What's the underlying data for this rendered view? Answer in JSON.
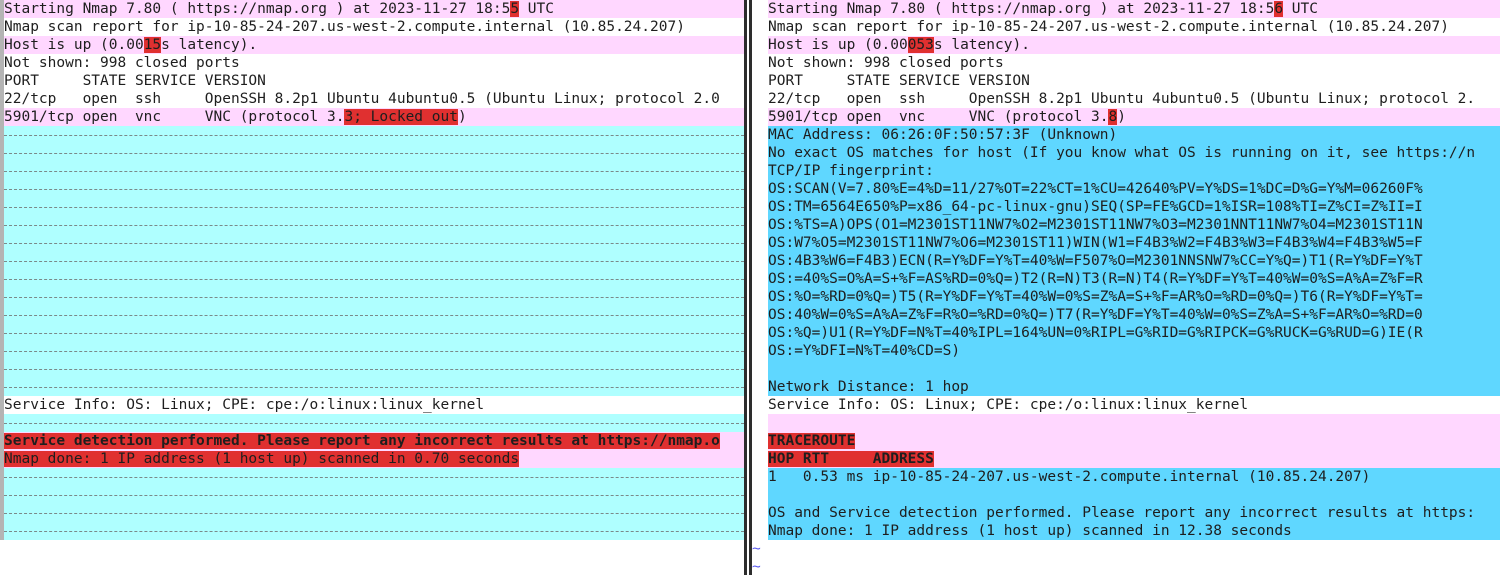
{
  "left": {
    "header1": {
      "pre": "Starting Nmap 7.80 ( https://nmap.org ) at 2023-11-27 18:5",
      "hl": "5",
      "post": " UTC"
    },
    "header2": "Nmap scan report for ip-10-85-24-207.us-west-2.compute.internal (10.85.24.207)",
    "latency": {
      "pre": "Host is up (0.00",
      "hl": "15",
      "post": "s latency)."
    },
    "closed": "Not shown: 998 closed ports",
    "columns": "PORT     STATE SERVICE VERSION",
    "ssh_row": "22/tcp   open  ssh     OpenSSH 8.2p1 Ubuntu 4ubuntu0.5 (Ubuntu Linux; protocol 2.0",
    "vnc_row": {
      "pre": "5901/tcp open  vnc     VNC (protocol 3.",
      "hl": "3; Locked out",
      "post": ")"
    },
    "service_info": "Service Info: OS: Linux; CPE: cpe:/o:linux:linux_kernel",
    "detection": "Service detection performed. Please report any incorrect results at https://nmap.o",
    "done": "Nmap done: 1 IP address (1 host up) scanned in 0.70 seconds"
  },
  "right": {
    "header1": {
      "pre": "Starting Nmap 7.80 ( https://nmap.org ) at 2023-11-27 18:5",
      "hl": "6",
      "post": " UTC"
    },
    "header2": "Nmap scan report for ip-10-85-24-207.us-west-2.compute.internal (10.85.24.207)",
    "latency": {
      "pre": "Host is up (0.00",
      "hl": "053",
      "post": "s latency)."
    },
    "closed": "Not shown: 998 closed ports",
    "columns": "PORT     STATE SERVICE VERSION",
    "ssh_row": "22/tcp   open  ssh     OpenSSH 8.2p1 Ubuntu 4ubuntu0.5 (Ubuntu Linux; protocol 2.",
    "vnc_row": {
      "pre": "5901/tcp open  vnc     VNC (protocol 3.",
      "hl": "8",
      "post": ")"
    },
    "os_block": [
      "MAC Address: 06:26:0F:50:57:3F (Unknown)",
      "No exact OS matches for host (If you know what OS is running on it, see https://n",
      "TCP/IP fingerprint:",
      "OS:SCAN(V=7.80%E=4%D=11/27%OT=22%CT=1%CU=42640%PV=Y%DS=1%DC=D%G=Y%M=06260F%",
      "OS:TM=6564E650%P=x86_64-pc-linux-gnu)SEQ(SP=FE%GCD=1%ISR=108%TI=Z%CI=Z%II=I",
      "OS:%TS=A)OPS(O1=M2301ST11NW7%O2=M2301ST11NW7%O3=M2301NNT11NW7%O4=M2301ST11N",
      "OS:W7%O5=M2301ST11NW7%O6=M2301ST11)WIN(W1=F4B3%W2=F4B3%W3=F4B3%W4=F4B3%W5=F",
      "OS:4B3%W6=F4B3)ECN(R=Y%DF=Y%T=40%W=F507%O=M2301NNSNW7%CC=Y%Q=)T1(R=Y%DF=Y%T",
      "OS:=40%S=O%A=S+%F=AS%RD=0%Q=)T2(R=N)T3(R=N)T4(R=Y%DF=Y%T=40%W=0%S=A%A=Z%F=R",
      "OS:%O=%RD=0%Q=)T5(R=Y%DF=Y%T=40%W=0%S=Z%A=S+%F=AR%O=%RD=0%Q=)T6(R=Y%DF=Y%T=",
      "OS:40%W=0%S=A%A=Z%F=R%O=%RD=0%Q=)T7(R=Y%DF=Y%T=40%W=0%S=Z%A=S+%F=AR%O=%RD=0",
      "OS:%Q=)U1(R=Y%DF=N%T=40%IPL=164%UN=0%RIPL=G%RID=G%RIPCK=G%RUCK=G%RUD=G)IE(R",
      "OS:=Y%DFI=N%T=40%CD=S)",
      "",
      "Network Distance: 1 hop"
    ],
    "service_info": "Service Info: OS: Linux; CPE: cpe:/o:linux:linux_kernel",
    "traceroute": "TRACEROUTE",
    "trace_header": "HOP RTT     ADDRESS",
    "trace_row": "1   0.53 ms ip-10-85-24-207.us-west-2.compute.internal (10.85.24.207)",
    "detection": "OS and Service detection performed. Please report any incorrect results at https:",
    "done": "Nmap done: 1 IP address (1 host up) scanned in 12.38 seconds"
  },
  "filler_glyph": "~",
  "colors": {
    "added": "#ffd7ff",
    "changed_text": "#5fd7ff",
    "filler": "#afffff",
    "highlight": "#e03030"
  }
}
